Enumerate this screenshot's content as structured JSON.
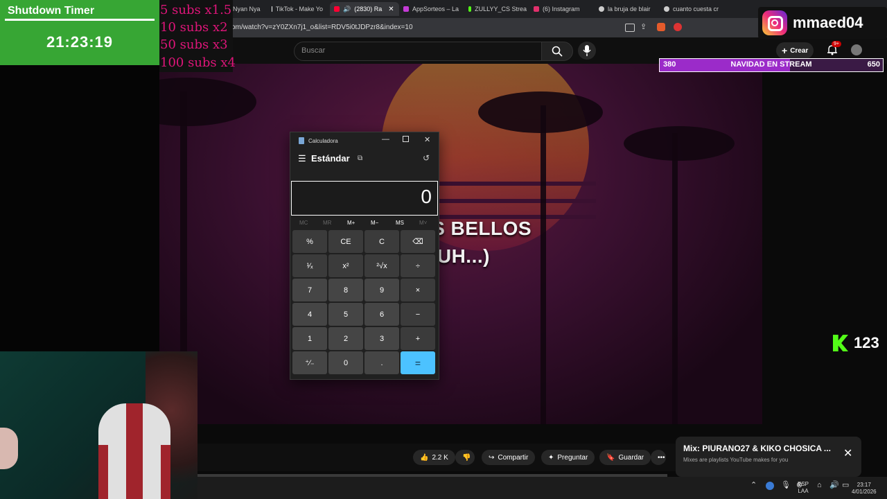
{
  "timer_overlay": {
    "title": "Shutdown Timer",
    "time": "21:23:19"
  },
  "subs_overlay": [
    "5 subs x1.5",
    "10 subs x2",
    "50 subs x3",
    "100 subs x4"
  ],
  "browser": {
    "tabs": [
      {
        "label": "Nyan Nya",
        "color": "#888"
      },
      {
        "label": "TikTok - Make Yo",
        "color": "#fff"
      },
      {
        "label": "(2830) Ra",
        "color": "#ff0033",
        "active": true
      },
      {
        "label": "AppSorteos – La",
        "color": "#c43bd6"
      },
      {
        "label": "ZULLYY_CS Strea",
        "color": "#53fc18"
      },
      {
        "label": "(6) Instagram",
        "color": "#e1306c"
      },
      {
        "label": "la bruja de blair",
        "color": "#ccc"
      },
      {
        "label": "cuanto cuesta cr",
        "color": "#ccc"
      }
    ],
    "url": "om/watch?v=zY0ZXn7j1_o&list=RDV5i0tJDPzr8&index=10"
  },
  "youtube": {
    "search_placeholder": "Buscar",
    "create_label": "Crear",
    "notif_badge": "9+",
    "like_count": "2.2 K",
    "share_label": "Compartir",
    "ask_label": "Preguntar",
    "save_label": "Guardar",
    "mix_title": "Mix: PIURANO27 & KIKO CHOSICA ...",
    "mix_subtitle": "Mixes are playlists YouTube makes for you"
  },
  "video": {
    "lyric_line1": "MIS OJOS BELLOS",
    "lyric_line2": "(UH, UH...)"
  },
  "instagram_overlay": {
    "handle": "mmaed04"
  },
  "goal_bar": {
    "current": "380",
    "label": "NAVIDAD EN STREAM",
    "goal": "650",
    "progress": 0.585
  },
  "kick_overlay": {
    "count": "123"
  },
  "calculator": {
    "window_title": "Calculadora",
    "mode": "Estándar",
    "display": "0",
    "memory": [
      "MC",
      "MR",
      "M+",
      "M−",
      "MS",
      "M˅"
    ],
    "keys": [
      [
        "%",
        "CE",
        "C",
        "⌫"
      ],
      [
        "¹⁄ₓ",
        "x²",
        "²√x",
        "÷"
      ],
      [
        "7",
        "8",
        "9",
        "×"
      ],
      [
        "4",
        "5",
        "6",
        "−"
      ],
      [
        "1",
        "2",
        "3",
        "+"
      ],
      [
        "⁺⁄₋",
        "0",
        ".",
        "="
      ]
    ]
  },
  "taskbar": {
    "lang": "ESP",
    "lang2": "LAA",
    "time": "23:17",
    "date": "4/01/2026"
  },
  "colors": {
    "timer_bg": "#37a634",
    "subs_text": "#e0157a",
    "goal_fill": "#9b2bc9",
    "kick": "#53fc18",
    "equals": "#4cc2ff"
  }
}
